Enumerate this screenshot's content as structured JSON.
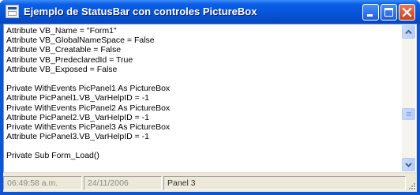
{
  "window": {
    "title": "Ejemplo de StatusBar con controles PictureBox"
  },
  "editor": {
    "lines": [
      "Attribute VB_Name = \"Form1\"",
      "Attribute VB_GlobalNameSpace = False",
      "Attribute VB_Creatable = False",
      "Attribute VB_PredeclaredId = True",
      "Attribute VB_Exposed = False",
      "",
      "Private WithEvents PicPanel1 As PictureBox",
      "Attribute PicPanel1.VB_VarHelpID = -1",
      "Private WithEvents PicPanel2 As PictureBox",
      "Attribute PicPanel2.VB_VarHelpID = -1",
      "Private WithEvents PicPanel3 As PictureBox",
      "Attribute PicPanel3.VB_VarHelpID = -1",
      "",
      "Private Sub Form_Load()",
      ""
    ]
  },
  "statusbar": {
    "time": "06:49:58 a.m.",
    "date": "24/11/2006",
    "panel3": "Panel 3"
  },
  "scrollbar": {
    "position": 0.65
  }
}
